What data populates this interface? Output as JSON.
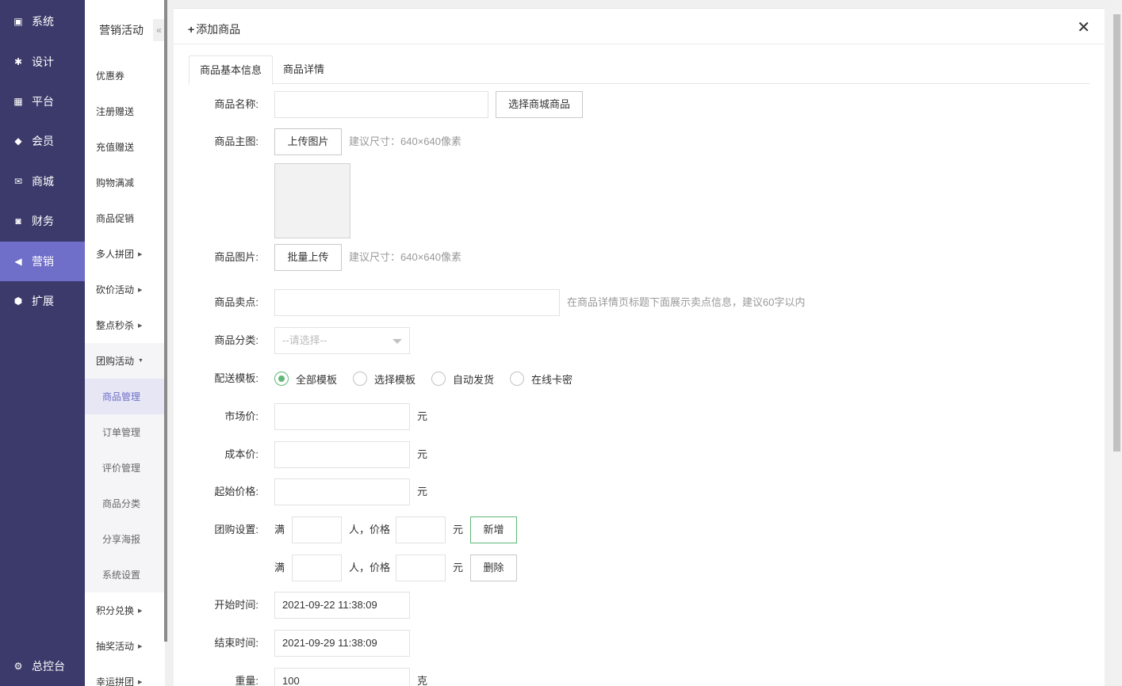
{
  "nav1": {
    "items": [
      {
        "label": "系统",
        "icon": "monitor-icon"
      },
      {
        "label": "设计",
        "icon": "puzzle-icon"
      },
      {
        "label": "平台",
        "icon": "grid-icon"
      },
      {
        "label": "会员",
        "icon": "diamond-icon"
      },
      {
        "label": "商城",
        "icon": "envelope-icon"
      },
      {
        "label": "财务",
        "icon": "cashbox-icon"
      },
      {
        "label": "营销",
        "icon": "megaphone-icon",
        "active": true
      },
      {
        "label": "扩展",
        "icon": "cube-icon"
      }
    ],
    "dashboard": {
      "label": "总控台",
      "icon": "gear-icon"
    },
    "active_color": "#6f6ec8",
    "bg_color": "#3b3a6b"
  },
  "nav2": {
    "header": "营销活动",
    "collapse_glyph": "«",
    "items": [
      "优惠券",
      "注册赠送",
      "充值赠送",
      "购物满减",
      "商品促销",
      "多人拼团",
      "砍价活动",
      "整点秒杀",
      "团购活动"
    ],
    "sub_items": [
      "商品管理",
      "订单管理",
      "评价管理",
      "商品分类",
      "分享海报",
      "系统设置"
    ],
    "after_items": [
      "积分兑换",
      "抽奖活动",
      "幸运拼团"
    ]
  },
  "panel": {
    "title": "添加商品",
    "tabs": [
      "商品基本信息",
      "商品详情"
    ]
  },
  "form": {
    "name_label": "商品名称:",
    "name_value": "",
    "select_mall_button": "选择商城商品",
    "main_image_label": "商品主图:",
    "upload_button": "上传图片",
    "size_hint": "建议尺寸：640×640像素",
    "images_label": "商品图片:",
    "batch_upload_button": "批量上传",
    "selling_label": "商品卖点:",
    "selling_hint": "在商品详情页标题下面展示卖点信息，建议60字以内",
    "category_label": "商品分类:",
    "category_placeholder": "--请选择--",
    "delivery_label": "配送模板:",
    "delivery_options": [
      "全部模板",
      "选择模板",
      "自动发货",
      "在线卡密"
    ],
    "market_price_label": "市场价:",
    "cost_price_label": "成本价:",
    "start_price_label": "起始价格:",
    "yuan": "元",
    "group_label": "团购设置:",
    "man": "满",
    "people_price": "人，价格",
    "add_button": "新增",
    "delete_button": "删除",
    "start_time_label": "开始时间:",
    "start_time": "2021-09-22 11:38:09",
    "end_time_label": "结束时间:",
    "end_time": "2021-09-29 11:38:09",
    "weight_label": "重量:",
    "weight_value": "100",
    "weight_unit": "克"
  }
}
